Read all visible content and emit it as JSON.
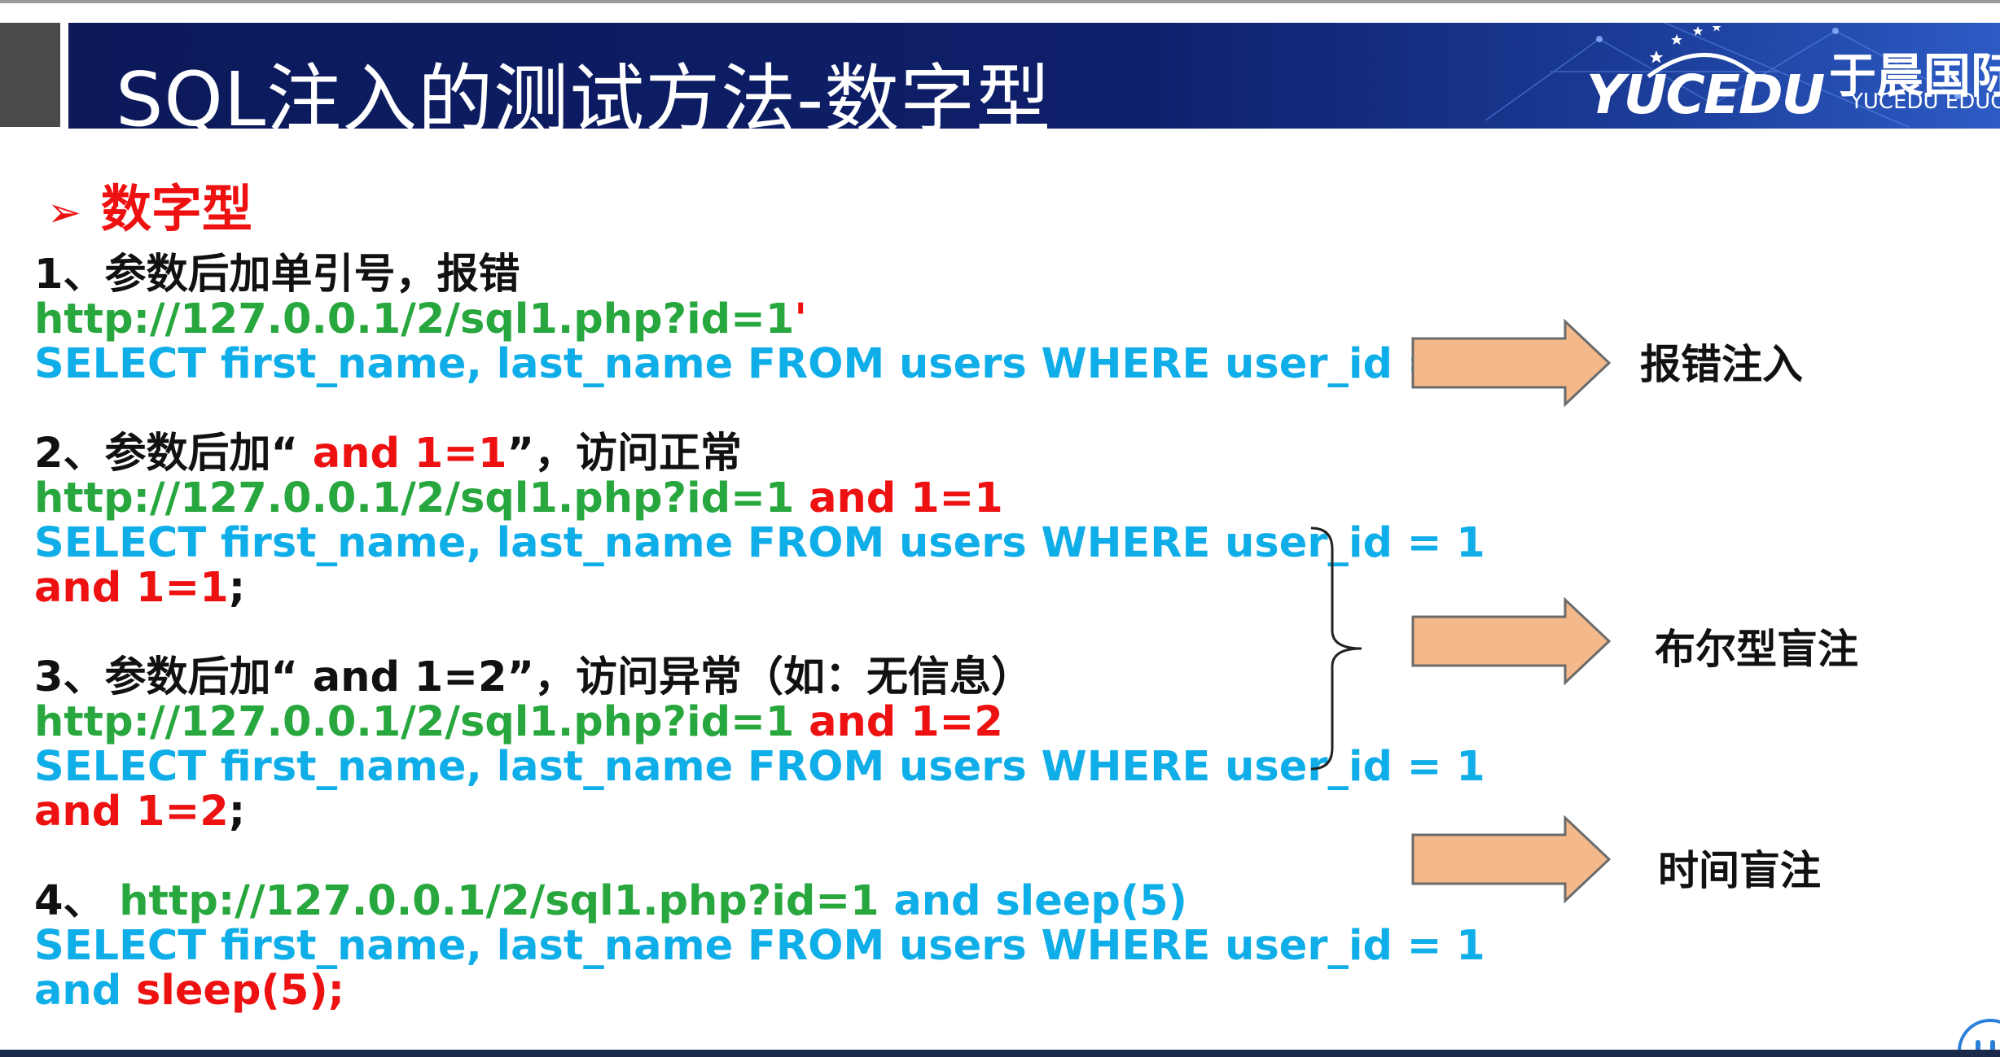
{
  "header": {
    "title": "SQL注入的测试方法-数字型",
    "logo_text": "YUCEDU",
    "logo_cn": "于晨国际IT",
    "logo_en": "YUCEDU  EDUCATION"
  },
  "section": {
    "bullet": "➢",
    "title": "数字型"
  },
  "items": [
    {
      "heading": "1、参数后加单引号，报错",
      "url": "http://127.0.0.1/2/sql1.php?id=1",
      "url_suffix": "'",
      "sql": "SELECT first_name, last_name FROM users WHERE user_id = 1",
      "sql_suffix": "'",
      "sql_end": ";"
    },
    {
      "heading_pre": "2、参数后加“ ",
      "heading_red": "and 1=1",
      "heading_post": "”，访问正常",
      "url": "http://127.0.0.1/2/sql1.php?id=1 ",
      "url_suffix": "and 1=1",
      "sql": "SELECT first_name, last_name FROM users WHERE user_id = 1",
      "sql_line2": "and 1=1",
      "sql_end": ";"
    },
    {
      "heading": "3、参数后加“ and 1=2”，访问异常（如：无信息）",
      "url": "http://127.0.0.1/2/sql1.php?id=1 ",
      "url_suffix": "and 1=2",
      "sql": "SELECT first_name, last_name FROM users WHERE user_id = 1",
      "sql_line2": "and 1=2",
      "sql_end": ";"
    },
    {
      "num": "4、 ",
      "url": "http://127.0.0.1/2/sql1.php?id=1",
      "url_suffix": " and sleep(5)",
      "sql": "SELECT first_name, last_name FROM users WHERE user_id = 1",
      "sql_line2_pre": "and ",
      "sql_line2_red": "sleep(5);"
    }
  ],
  "labels": {
    "error": "报错注入",
    "boolean": "布尔型盲注",
    "time": "时间盲注"
  },
  "colors": {
    "header_bg": "#0e1f6a",
    "green": "#27a73d",
    "blue": "#10aee8",
    "red": "#ee1111",
    "arrow_fill": "#f4b98a",
    "arrow_stroke": "#6b6b6b"
  }
}
